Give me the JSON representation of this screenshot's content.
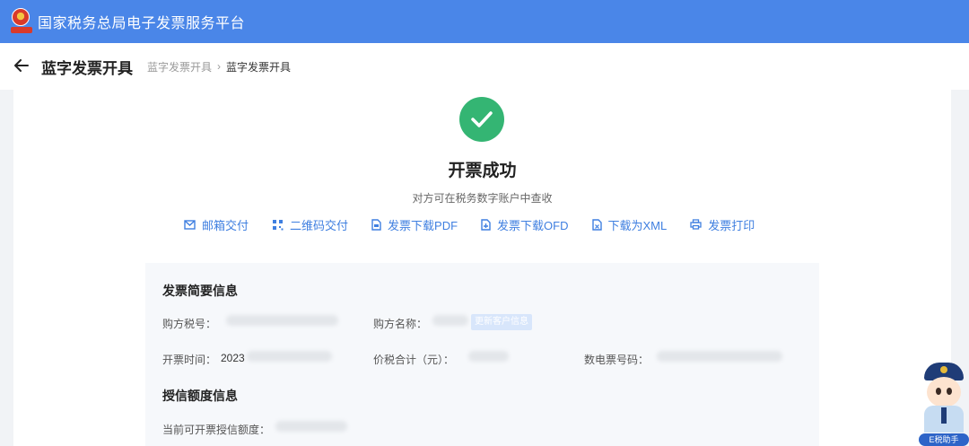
{
  "topbar": {
    "title": "国家税务总局电子发票服务平台",
    "logo_icon": "tax-emblem-icon"
  },
  "header": {
    "title": "蓝字发票开具",
    "breadcrumb": [
      "蓝字发票开具",
      "蓝字发票开具"
    ]
  },
  "result": {
    "title": "开票成功",
    "subtitle": "对方可在税务数字账户中查收",
    "icon": "check-circle-icon",
    "color": "#34b573"
  },
  "actions": [
    {
      "label": "邮箱交付",
      "icon": "mail-icon"
    },
    {
      "label": "二维码交付",
      "icon": "qrcode-icon"
    },
    {
      "label": "发票下载PDF",
      "icon": "pdf-file-icon"
    },
    {
      "label": "发票下载OFD",
      "icon": "ofd-file-icon"
    },
    {
      "label": "下载为XML",
      "icon": "xml-file-icon"
    },
    {
      "label": "发票打印",
      "icon": "printer-icon"
    }
  ],
  "summary": {
    "title": "发票简要信息",
    "buyer_tax_id_label": "购方税号：",
    "buyer_name_label": "购方名称：",
    "update_customer_button": "更新客户信息",
    "issue_time_label": "开票时间：",
    "issue_time_value": "2023",
    "total_label": "价税合计（元）：",
    "invoice_number_label": "数电票号码："
  },
  "credit": {
    "title": "授信额度信息",
    "available_label": "当前可开票授信额度："
  },
  "mascot": {
    "label": "E税助手"
  },
  "colors": {
    "brand": "#4a86e8",
    "link": "#3f7fe0",
    "success": "#34b573"
  }
}
